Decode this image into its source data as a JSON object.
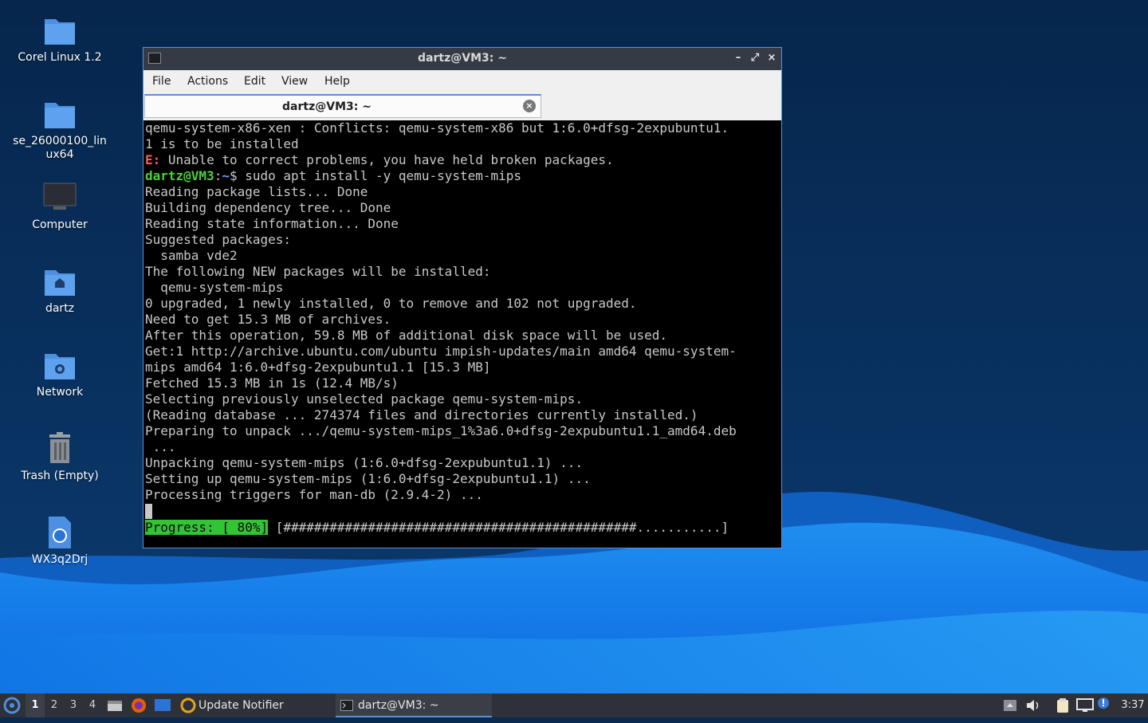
{
  "desktop": {
    "icons": [
      {
        "label": "Corel Linux 1.2",
        "icon": "folder-icon"
      },
      {
        "label": "se_26000100_lin\nux64",
        "icon": "folder-icon"
      },
      {
        "label": "Computer",
        "icon": "computer-icon"
      },
      {
        "label": "dartz",
        "icon": "home-folder-icon"
      },
      {
        "label": "Network",
        "icon": "network-folder-icon"
      },
      {
        "label": "Trash (Empty)",
        "icon": "trash-icon"
      },
      {
        "label": "WX3q2Drj",
        "icon": "web-file-icon"
      }
    ]
  },
  "window": {
    "title": "dartz@VM3: ~",
    "menu": [
      "File",
      "Actions",
      "Edit",
      "View",
      "Help"
    ],
    "tab_title": "dartz@VM3: ~",
    "controls": {
      "minimize": "–",
      "maximize": "⤢",
      "close": "×"
    }
  },
  "terminal": {
    "lines": [
      "qemu-system-x86-xen : Conflicts: qemu-system-x86 but 1:6.0+dfsg-2expubuntu1.",
      "1 is to be installed",
      "Unable to correct problems, you have held broken packages.",
      " sudo apt install -y qemu-system-mips",
      "Reading package lists... Done",
      "Building dependency tree... Done",
      "Reading state information... Done",
      "Suggested packages:",
      "  samba vde2",
      "The following NEW packages will be installed:",
      "  qemu-system-mips",
      "0 upgraded, 1 newly installed, 0 to remove and 102 not upgraded.",
      "Need to get 15.3 MB of archives.",
      "After this operation, 59.8 MB of additional disk space will be used.",
      "Get:1 http://archive.ubuntu.com/ubuntu impish-updates/main amd64 qemu-system-",
      "mips amd64 1:6.0+dfsg-2expubuntu1.1 [15.3 MB]",
      "Fetched 15.3 MB in 1s (12.4 MB/s)",
      "Selecting previously unselected package qemu-system-mips.",
      "(Reading database ... 274374 files and directories currently installed.)",
      "Preparing to unpack .../qemu-system-mips_1%3a6.0+dfsg-2expubuntu1.1_amd64.deb",
      " ...",
      "Unpacking qemu-system-mips (1:6.0+dfsg-2expubuntu1.1) ...",
      "Setting up qemu-system-mips (1:6.0+dfsg-2expubuntu1.1) ...",
      "Processing triggers for man-db (2.9.4-2) ..."
    ],
    "error_prefix": "E:",
    "prompt_user": "dartz@VM3",
    "prompt_sep": ":",
    "prompt_path": "~",
    "prompt_dollar": "$",
    "progress_label": "Progress: [ 80%]",
    "progress_bar": " [##############################################...........]",
    "progress_value": 0.8
  },
  "taskbar": {
    "workspaces": [
      "1",
      "2",
      "3",
      "4"
    ],
    "active_workspace": "1",
    "update_notifier": "Update Notifier",
    "task_terminal": "dartz@VM3: ~",
    "clock": "3:37"
  },
  "colors": {
    "accent": "#5b8fd6",
    "prompt_green": "#4cd137",
    "error_red": "#ff5a5a",
    "progress_green": "#33c436"
  }
}
